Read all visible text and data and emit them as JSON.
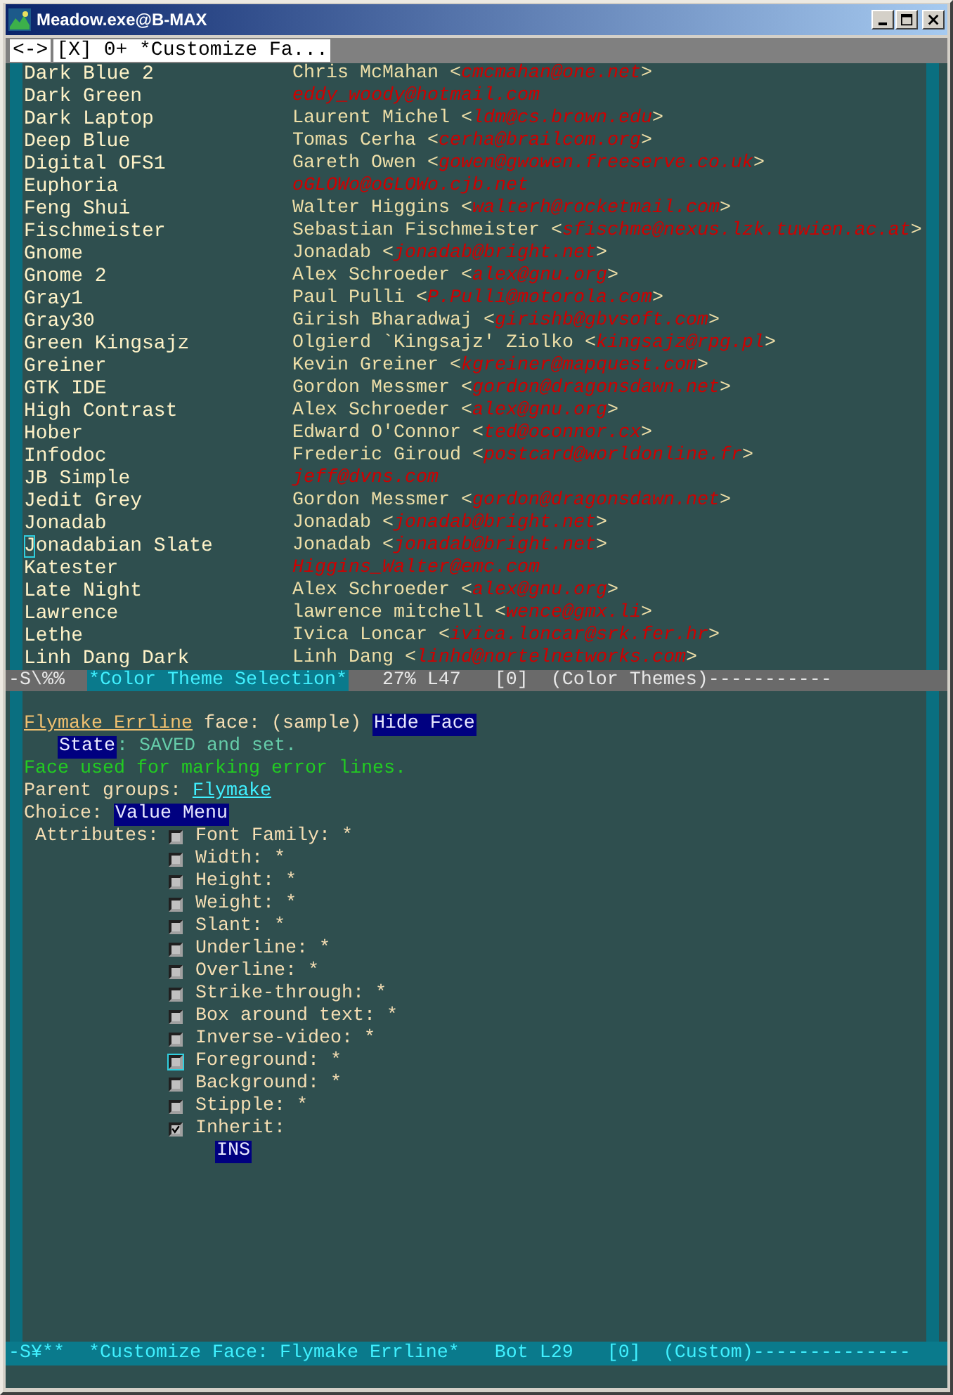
{
  "window": {
    "title": "Meadow.exe@B-MAX"
  },
  "tab_line": {
    "scroll": "<->",
    "tabs": [
      {
        "label": "[X] 0+ *Customize Fa...",
        "selected": true
      }
    ]
  },
  "themes": [
    {
      "name": "Dark Blue 2",
      "author": "Chris McMahan <",
      "email": "cmcmahan@one.net",
      "end": ">",
      "cursor": false
    },
    {
      "name": "Dark Green",
      "email": "eddy_woody@hotmail.com",
      "cursor": false
    },
    {
      "name": "Dark Laptop",
      "author": "Laurent Michel <",
      "email": "ldm@cs.brown.edu",
      "end": ">",
      "cursor": false
    },
    {
      "name": "Deep Blue",
      "author": "Tomas Cerha <",
      "email": "cerha@brailcom.org",
      "end": ">",
      "cursor": false
    },
    {
      "name": "Digital OFS1",
      "author": "Gareth Owen <",
      "email": "gowen@gwowen.freeserve.co.uk",
      "end": ">",
      "cursor": false
    },
    {
      "name": "Euphoria",
      "email": "oGLOWo@oGLOWo.cjb.net",
      "cursor": false
    },
    {
      "name": "Feng Shui",
      "author": "Walter Higgins <",
      "email": "walterh@rocketmail.com",
      "end": ">",
      "cursor": false
    },
    {
      "name": "Fischmeister",
      "author": "Sebastian Fischmeister <",
      "email": "sfischme@nexus.lzk.tuwien.ac.at",
      "end": ">",
      "cursor": false
    },
    {
      "name": "Gnome",
      "author": "Jonadab <",
      "email": "jonadab@bright.net",
      "end": ">",
      "cursor": false
    },
    {
      "name": "Gnome 2",
      "author": "Alex Schroeder <",
      "email": "alex@gnu.org",
      "end": ">",
      "cursor": false
    },
    {
      "name": "Gray1",
      "author": "Paul Pulli <",
      "email": "P.Pulli@motorola.com",
      "end": ">",
      "cursor": false
    },
    {
      "name": "Gray30",
      "author": "Girish Bharadwaj <",
      "email": "girishb@gbvsoft.com",
      "end": ">",
      "cursor": false
    },
    {
      "name": "Green Kingsajz",
      "author": "Olgierd `Kingsajz' Ziolko <",
      "email": "kingsajz@rpg.pl",
      "end": ">",
      "cursor": false
    },
    {
      "name": "Greiner",
      "author": "Kevin Greiner <",
      "email": "kgreiner@mapquest.com",
      "end": ">",
      "cursor": false
    },
    {
      "name": "GTK IDE",
      "author": "Gordon Messmer <",
      "email": "gordon@dragonsdawn.net",
      "end": ">",
      "cursor": false
    },
    {
      "name": "High Contrast",
      "author": "Alex Schroeder <",
      "email": "alex@gnu.org",
      "end": ">",
      "cursor": false
    },
    {
      "name": "Hober",
      "author": "Edward O'Connor <",
      "email": "ted@oconnor.cx",
      "end": ">",
      "cursor": false
    },
    {
      "name": "Infodoc",
      "author": "Frederic Giroud <",
      "email": "postcard@worldonline.fr",
      "end": ">",
      "cursor": false
    },
    {
      "name": "JB Simple",
      "email": "jeff@dvns.com",
      "cursor": false
    },
    {
      "name": "Jedit Grey",
      "author": "Gordon Messmer <",
      "email": "gordon@dragonsdawn.net",
      "end": ">",
      "cursor": false
    },
    {
      "name": "Jonadab",
      "author": "Jonadab <",
      "email": "jonadab@bright.net",
      "end": ">",
      "cursor": false
    },
    {
      "name": "Jonadabian Slate",
      "author": "Jonadab <",
      "email": "jonadab@bright.net",
      "end": ">",
      "cursor": true
    },
    {
      "name": "Katester",
      "email": "Higgins_Walter@emc.com",
      "cursor": false
    },
    {
      "name": "Late Night",
      "author": "Alex Schroeder <",
      "email": "alex@gnu.org",
      "end": ">",
      "cursor": false
    },
    {
      "name": "Lawrence",
      "author": "lawrence mitchell <",
      "email": "wence@gmx.li",
      "end": ">",
      "cursor": false
    },
    {
      "name": "Lethe",
      "author": "Ivica Loncar <",
      "email": "ivica.loncar@srk.fer.hr",
      "end": ">",
      "cursor": false
    },
    {
      "name": "Linh Dang Dark",
      "author": "Linh Dang <",
      "email": "linhd@nortelnetworks.com",
      "end": ">",
      "cursor": false
    }
  ],
  "mode_lines": [
    {
      "active": false,
      "flags": "-S\\%%",
      "buffer": "*Color Theme Selection*",
      "position": "27% L47",
      "depth": "[0]",
      "mode": "(Color Themes)-----------"
    },
    {
      "active": true,
      "flags": "-S¥**",
      "buffer": "*Customize Face: Flymake Errline*",
      "position": "Bot L29",
      "depth": "[0]",
      "mode": "(Custom)--------------"
    }
  ],
  "face": {
    "name": "Flymake Errline",
    "suffix": "face: (sample)",
    "hide_button": "Hide Face",
    "state_button": "State",
    "state_text": ": SAVED and set.",
    "doc": "Face used for marking error lines.",
    "parent_label": "Parent groups:",
    "parent_link": "Flymake",
    "choice_label": "Choice:",
    "choice_button": "Value Menu",
    "attributes_label": "Attributes:",
    "ins_button": "INS"
  },
  "attributes": [
    {
      "label": "Font Family: *",
      "checked": false,
      "cursor": false
    },
    {
      "label": "Width: *",
      "checked": false,
      "cursor": false
    },
    {
      "label": "Height: *",
      "checked": false,
      "cursor": false
    },
    {
      "label": "Weight: *",
      "checked": false,
      "cursor": false
    },
    {
      "label": "Slant: *",
      "checked": false,
      "cursor": false
    },
    {
      "label": "Underline: *",
      "checked": false,
      "cursor": false
    },
    {
      "label": "Overline: *",
      "checked": false,
      "cursor": false
    },
    {
      "label": "Strike-through: *",
      "checked": false,
      "cursor": false
    },
    {
      "label": "Box around text: *",
      "checked": false,
      "cursor": false
    },
    {
      "label": "Inverse-video: *",
      "checked": false,
      "cursor": false
    },
    {
      "label": "Foreground: *",
      "checked": false,
      "cursor": true
    },
    {
      "label": "Background: *",
      "checked": false,
      "cursor": false
    },
    {
      "label": "Stipple: *",
      "checked": false,
      "cursor": false
    },
    {
      "label": "Inherit:",
      "checked": true,
      "cursor": false
    }
  ]
}
